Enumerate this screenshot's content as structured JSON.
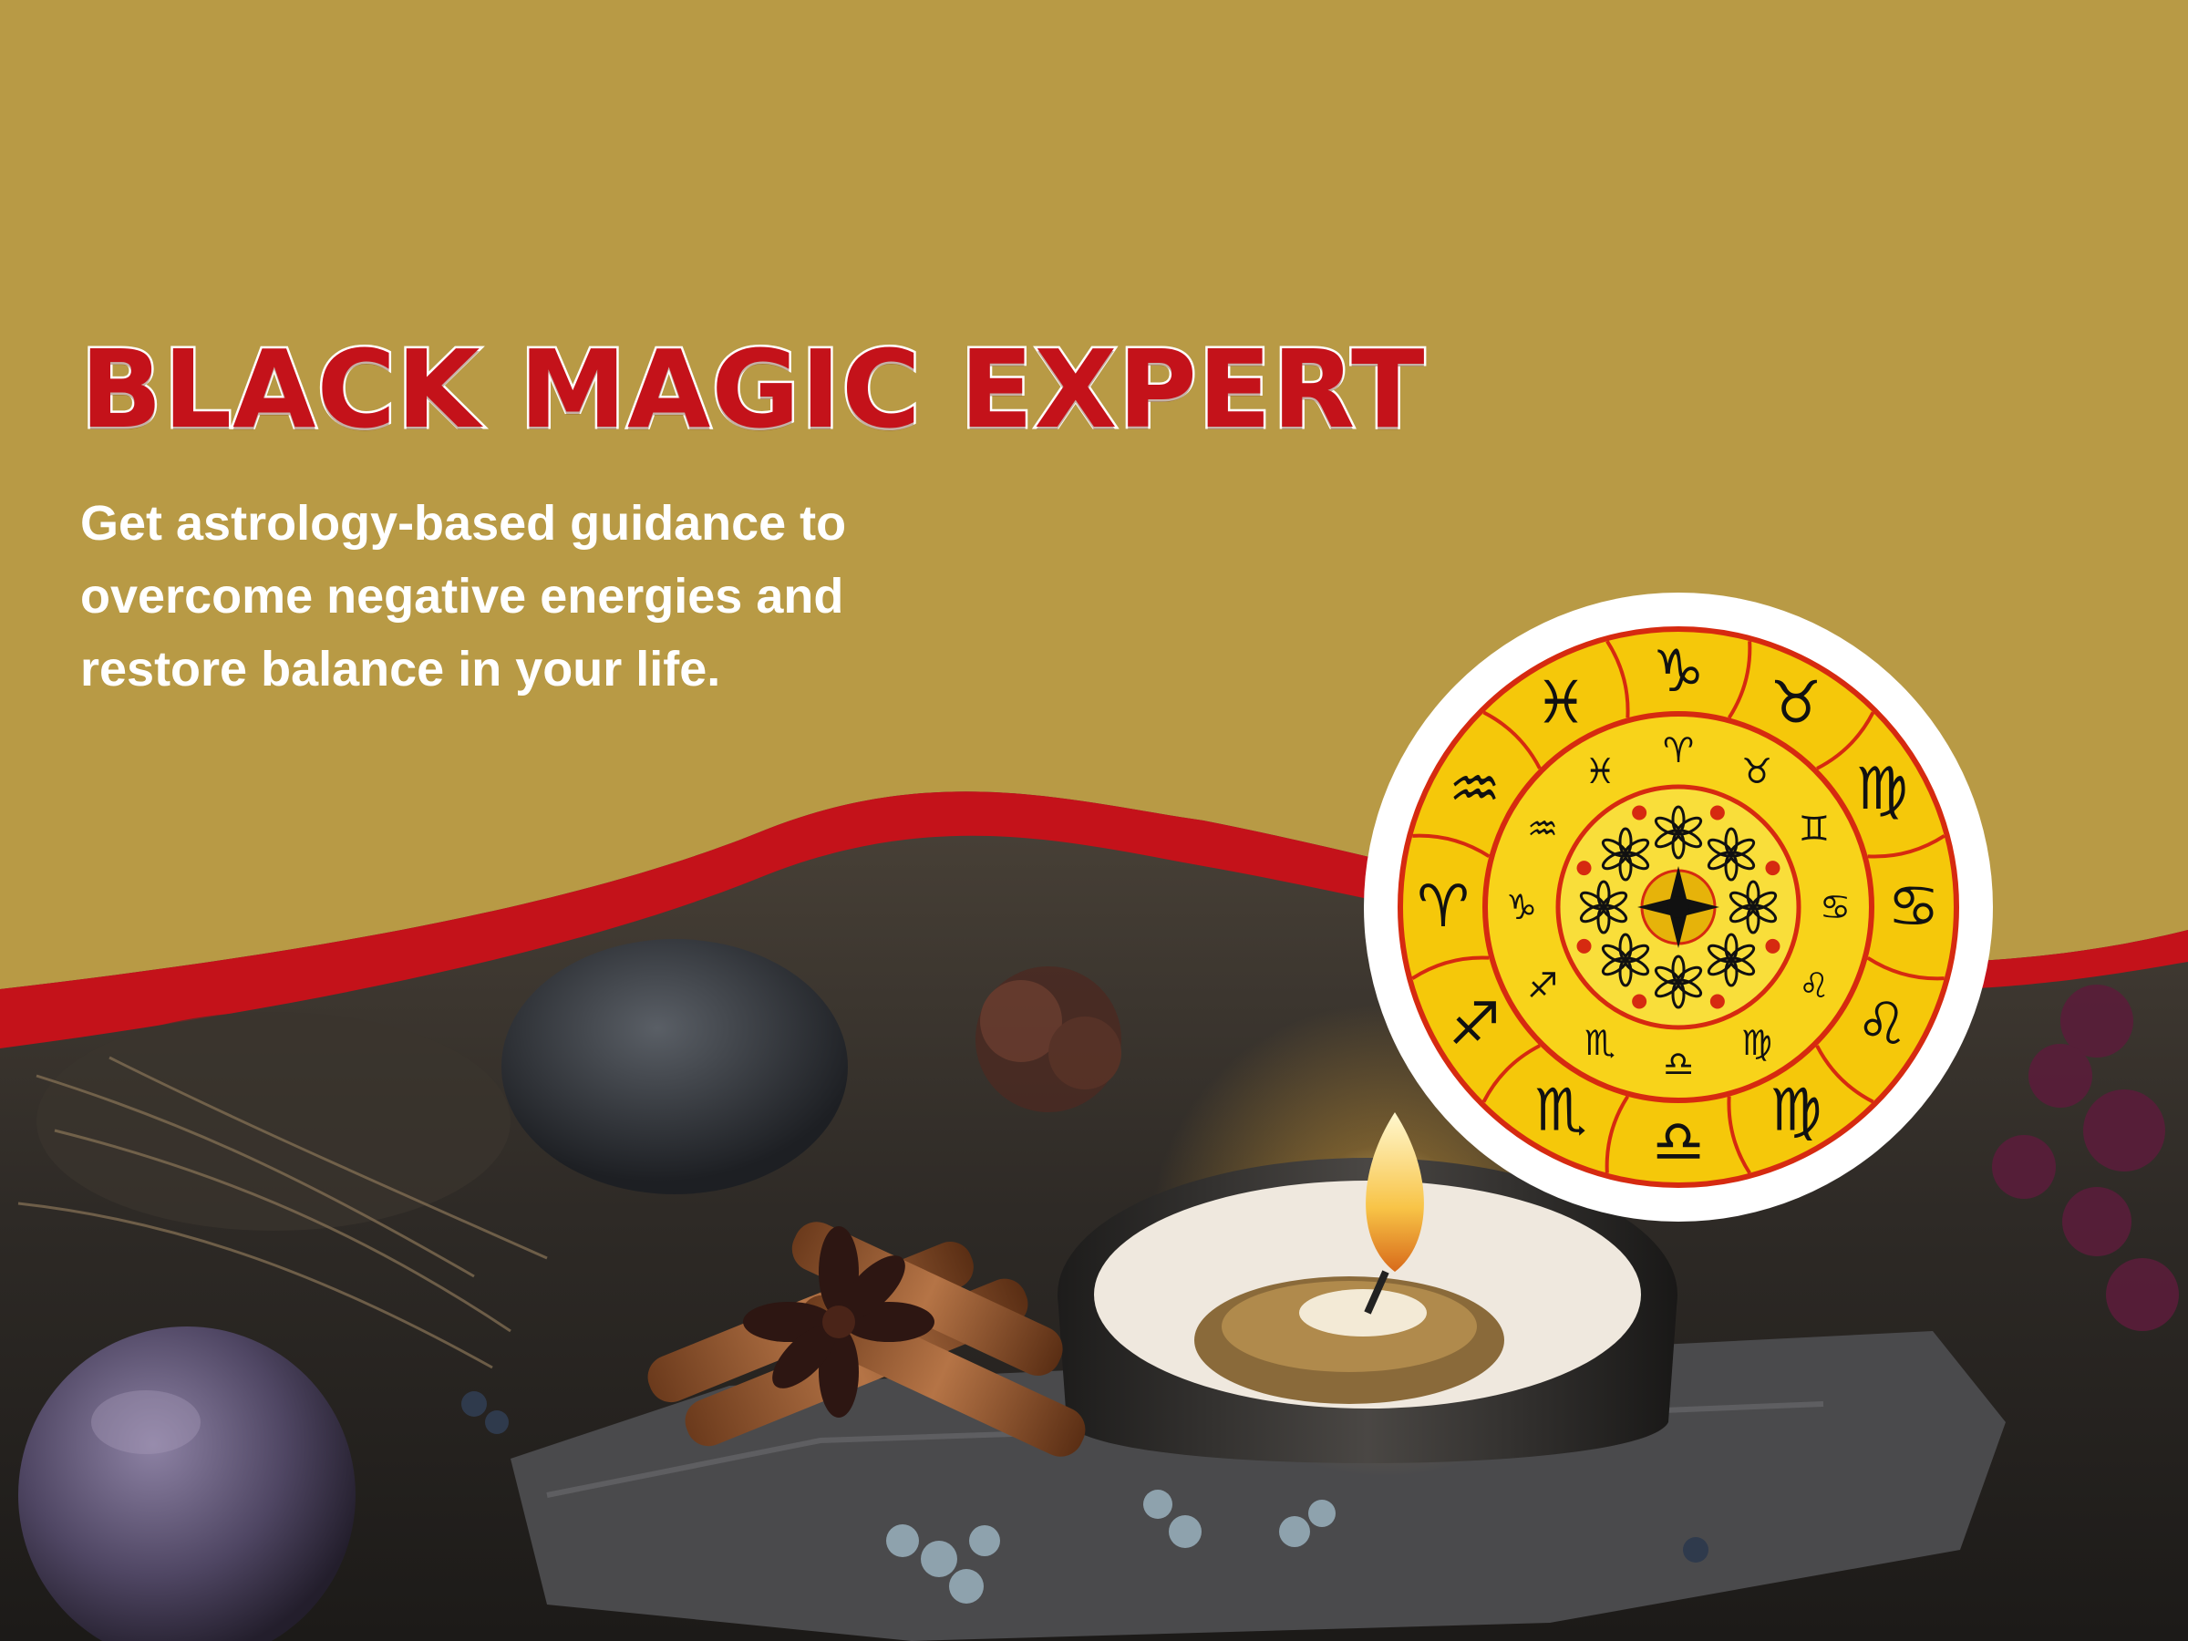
{
  "banner": {
    "headline": "BLACK MAGIC EXPERT",
    "subtitle_lines": [
      "Get astrology-based guidance to",
      "overcome negative energies and",
      "restore balance in your life."
    ]
  },
  "colors": {
    "background_gold": "#b89a45",
    "wave_red": "#c4121a",
    "headline_red": "#c4121a",
    "text_white": "#ffffff",
    "zodiac_yellow": "#f5c80a"
  },
  "illustration": {
    "zodiac_wheel_glyphs": [
      "♈",
      "♉",
      "♊",
      "♋",
      "♌",
      "♍",
      "♎",
      "♏",
      "♐",
      "♑",
      "♒",
      "♓"
    ],
    "zodiac_figure_icons": [
      "♑",
      "♉",
      "♍",
      "♋",
      "♌",
      "♍",
      "♎",
      "♏",
      "♐",
      "♈",
      "♒",
      "♓"
    ]
  }
}
